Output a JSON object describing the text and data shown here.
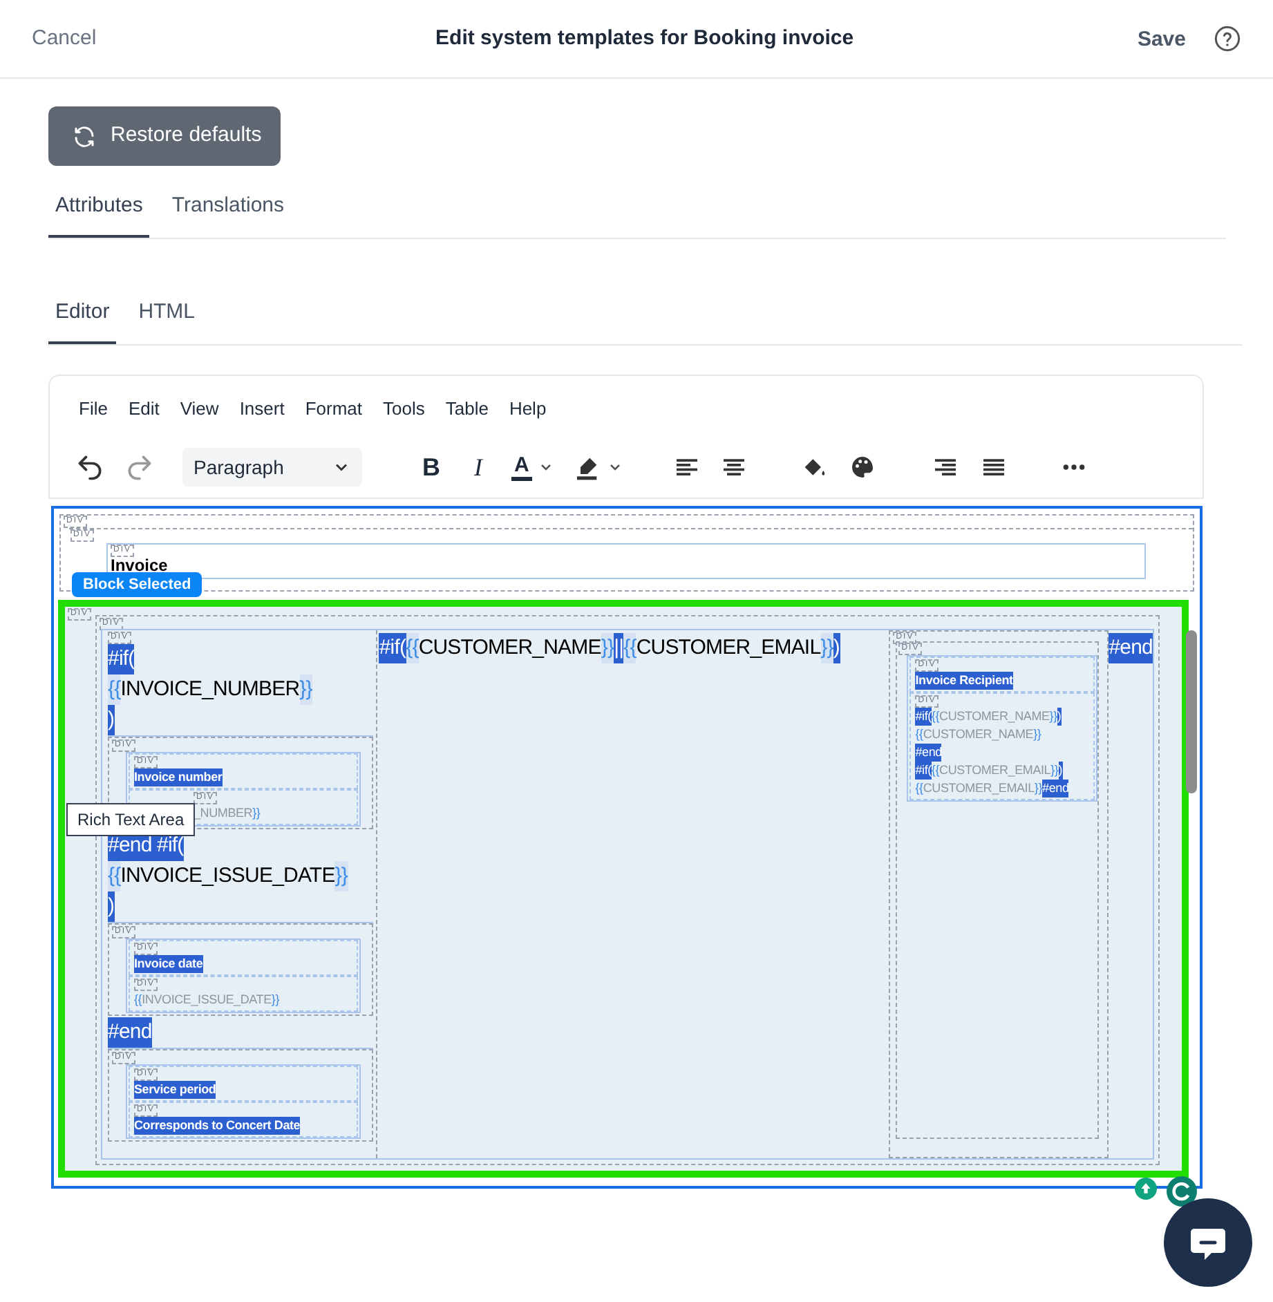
{
  "header": {
    "cancel": "Cancel",
    "title": "Edit system templates for Booking invoice",
    "save": "Save"
  },
  "restore_button": "Restore defaults",
  "tabs": [
    {
      "label": "Attributes",
      "selected": true
    },
    {
      "label": "Translations",
      "selected": false
    }
  ],
  "editor_tabs": [
    {
      "label": "Editor",
      "selected": true
    },
    {
      "label": "HTML",
      "selected": false
    }
  ],
  "menu": [
    "File",
    "Edit",
    "View",
    "Insert",
    "Format",
    "Tools",
    "Table",
    "Help"
  ],
  "toolbar": {
    "block_format": "Paragraph",
    "bold_glyph": "B",
    "italic_glyph": "I",
    "text_color_glyph": "A"
  },
  "content": {
    "top_block": {
      "div_labels": [
        "DIV",
        "DIV",
        "DIV"
      ],
      "text": "Invoice",
      "badge": "Block Selected"
    },
    "selected_block": {
      "div_labels": [
        "DIV",
        "DIV"
      ],
      "left_column": {
        "div_labels": [
          "DIV"
        ],
        "items": [
          {
            "kind": "lines",
            "lines": [
              [
                {
                  "kind": "tag",
                  "text": "#if("
                }
              ],
              [
                {
                  "kind": "brace",
                  "text": "{{"
                },
                {
                  "kind": "var",
                  "text": "INVOICE_NUMBER"
                },
                {
                  "kind": "brace",
                  "text": "}}"
                }
              ],
              [
                {
                  "kind": "tag",
                  "text": ")"
                }
              ]
            ]
          },
          {
            "kind": "block",
            "div_label": "DIV",
            "rows": [
              {
                "div_label": "DIV",
                "covered": false,
                "lines": [
                  [
                    {
                      "kind": "label",
                      "text": "Invoice number"
                    }
                  ]
                ]
              },
              {
                "div_label": "DIV",
                "covered": true,
                "lines": [
                  [
                    {
                      "kind": "var",
                      "text": "_NUMBER"
                    },
                    {
                      "kind": "brace",
                      "text": "}}"
                    }
                  ]
                ]
              }
            ]
          },
          {
            "kind": "lines",
            "lines": [
              [
                {
                  "kind": "tag",
                  "text": "#end #if("
                }
              ],
              [
                {
                  "kind": "brace",
                  "text": "{{"
                },
                {
                  "kind": "var",
                  "text": "INVOICE_ISSUE_DATE"
                },
                {
                  "kind": "brace",
                  "text": "}}"
                }
              ],
              [
                {
                  "kind": "tag",
                  "text": ")"
                }
              ]
            ]
          },
          {
            "kind": "block",
            "div_label": "DIV",
            "rows": [
              {
                "div_label": "DIV",
                "covered": false,
                "lines": [
                  [
                    {
                      "kind": "label",
                      "text": "Invoice date"
                    }
                  ]
                ]
              },
              {
                "div_label": "DIV",
                "covered": false,
                "lines": [
                  [
                    {
                      "kind": "brace",
                      "text": "{{"
                    },
                    {
                      "kind": "var",
                      "text": "INVOICE_ISSUE_DATE"
                    },
                    {
                      "kind": "brace",
                      "text": "}}"
                    }
                  ]
                ]
              }
            ]
          },
          {
            "kind": "lines",
            "lines": [
              [
                {
                  "kind": "tag",
                  "text": "#end"
                }
              ]
            ]
          },
          {
            "kind": "block",
            "div_label": "DIV",
            "rows": [
              {
                "div_label": "DIV",
                "covered": false,
                "lines": [
                  [
                    {
                      "kind": "label",
                      "text": "Service period"
                    }
                  ]
                ]
              },
              {
                "div_label": "DIV",
                "covered": false,
                "lines": [
                  [
                    {
                      "kind": "label",
                      "text": "Corresponds to Concert Date"
                    }
                  ]
                ]
              }
            ]
          }
        ]
      },
      "middle_line": [
        {
          "kind": "tag",
          "text": "#if("
        },
        {
          "kind": "brace",
          "text": "{{"
        },
        {
          "kind": "var",
          "text": "CUSTOMER_NAME"
        },
        {
          "kind": "brace",
          "text": "}}"
        },
        {
          "kind": "tag",
          "text": "||"
        },
        {
          "kind": "brace",
          "text": "{{"
        },
        {
          "kind": "var",
          "text": "CUSTOMER_EMAIL"
        },
        {
          "kind": "brace",
          "text": "}}"
        },
        {
          "kind": "tag",
          "text": ")"
        }
      ],
      "right_column": {
        "div_labels": [
          "DIV",
          "DIV"
        ],
        "rows": [
          {
            "div_label": "DIV",
            "covered": false,
            "lines": [
              [
                {
                  "kind": "label",
                  "text": "Invoice Recipient"
                }
              ]
            ]
          },
          {
            "div_label": "DIV",
            "covered": false,
            "lines": [
              [
                {
                  "kind": "tag",
                  "text": "#if("
                },
                {
                  "kind": "brace",
                  "text": "{{"
                },
                {
                  "kind": "var",
                  "text": "CUSTOMER_NAME"
                },
                {
                  "kind": "brace",
                  "text": "}}"
                },
                {
                  "kind": "tag",
                  "text": ")"
                }
              ],
              [
                {
                  "kind": "brace",
                  "text": "{{"
                },
                {
                  "kind": "var",
                  "text": "CUSTOMER_NAME"
                },
                {
                  "kind": "brace",
                  "text": "}}"
                }
              ],
              [
                {
                  "kind": "tag",
                  "text": "#end"
                }
              ],
              [
                {
                  "kind": "tag",
                  "text": "#if("
                },
                {
                  "kind": "brace",
                  "text": "{{"
                },
                {
                  "kind": "var",
                  "text": "CUSTOMER_EMAIL"
                },
                {
                  "kind": "brace",
                  "text": "}}"
                },
                {
                  "kind": "tag",
                  "text": ")"
                }
              ],
              [
                {
                  "kind": "brace",
                  "text": "{{"
                },
                {
                  "kind": "var",
                  "text": "CUSTOMER_EMAIL"
                },
                {
                  "kind": "brace",
                  "text": "}}"
                },
                {
                  "kind": "tag",
                  "text": "#end"
                }
              ]
            ]
          }
        ]
      },
      "end_tag": "#end"
    },
    "tooltip": "Rich Text Area"
  }
}
